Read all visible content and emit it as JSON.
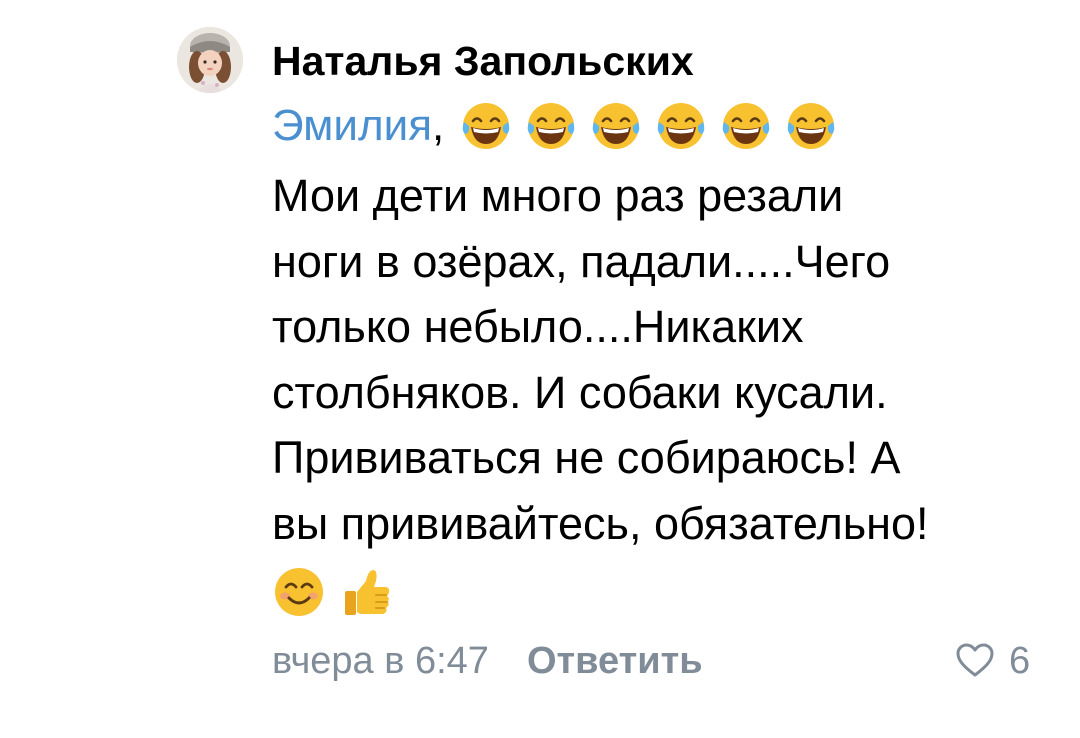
{
  "comment": {
    "author": "Наталья Запольских",
    "mention": "Эмилия",
    "mention_separator": ",",
    "reaction_emojis": [
      "tears-of-joy-emoji",
      "tears-of-joy-emoji",
      "tears-of-joy-emoji",
      "tears-of-joy-emoji",
      "tears-of-joy-emoji",
      "tears-of-joy-emoji"
    ],
    "text_lines": [
      "Мои дети много раз резали",
      "ноги в озёрах, падали.....Чего",
      "только небыло....Никаких",
      "столбняков. И собаки кусали.",
      "Прививаться не собираюсь! А",
      "вы прививайтесь, обязательно!"
    ],
    "end_emojis": [
      "smiling-face-emoji",
      "thumbs-up-emoji"
    ],
    "timestamp": "вчера в 6:47",
    "reply_label": "Ответить",
    "like_count": "6"
  },
  "colors": {
    "mention": "#4a8fd0",
    "meta": "#818c99",
    "text": "#000000"
  }
}
